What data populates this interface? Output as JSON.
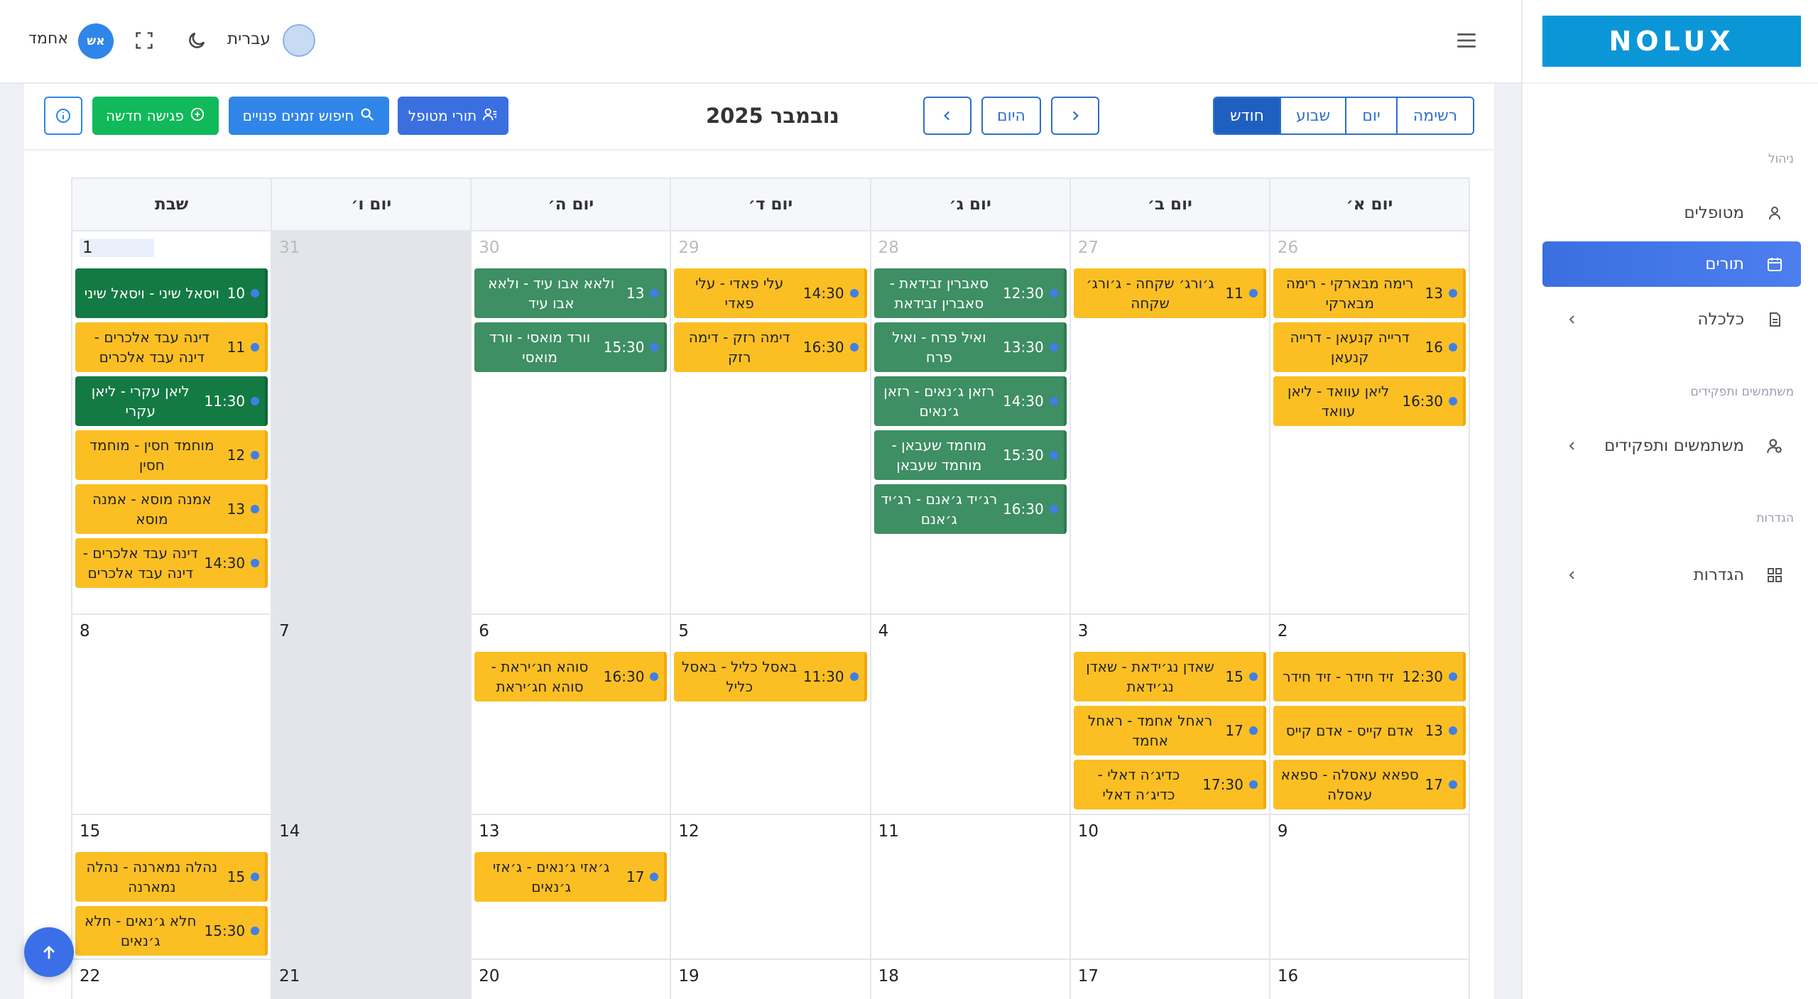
{
  "brand": {
    "logo_text": "NOLUX"
  },
  "sidebar": {
    "section_management": "ניהול",
    "section_users": "משתמשים ותפקידים",
    "section_settings": "הגדרות",
    "items": [
      {
        "label": "מטופלים"
      },
      {
        "label": "תורים"
      },
      {
        "label": "כלכלה"
      },
      {
        "label": "משתמשים ותפקידים"
      },
      {
        "label": "הגדרות"
      }
    ]
  },
  "topbar": {
    "user_name": "אחמד",
    "avatar_initials": "אש",
    "language": "עברית"
  },
  "toolbar": {
    "views": [
      "רשימה",
      "יום",
      "שבוע",
      "חודש"
    ],
    "active_view": "חודש",
    "today_label": "היום",
    "month_title": "נובמבר 2025",
    "patient_queue_label": "תורי מטופל",
    "find_slots_label": "חיפוש זמנים פנויים",
    "new_meeting_label": "פגישה חדשה"
  },
  "calendar": {
    "weekdays": [
      "יום א׳",
      "יום ב׳",
      "יום ג׳",
      "יום ד׳",
      "יום ה׳",
      "יום ו׳",
      "שבת"
    ],
    "weeks": [
      {
        "days": [
          {
            "num": "26",
            "other": true,
            "events": [
              {
                "time": "13",
                "title": "רימה מבארקי - רימה מבארקי",
                "color": "y"
              },
              {
                "time": "16",
                "title": "דרייה קנעאן - דרייה קנעאן",
                "color": "y"
              },
              {
                "time": "16:30",
                "title": "ליאן עוואד - ליאן עוואד",
                "color": "y"
              }
            ]
          },
          {
            "num": "27",
            "other": true,
            "events": [
              {
                "time": "11",
                "title": "ג׳ורג׳ שקחה - ג׳ורג׳ שקחה",
                "color": "y"
              }
            ]
          },
          {
            "num": "28",
            "other": true,
            "events": [
              {
                "time": "12:30",
                "title": "סאברין זבידאת - סאברין זבידאת",
                "color": "g"
              },
              {
                "time": "13:30",
                "title": "ואיל פרח - ואיל פרח",
                "color": "g"
              },
              {
                "time": "14:30",
                "title": "רזאן ג׳נאים - רזאן ג׳נאים",
                "color": "g"
              },
              {
                "time": "15:30",
                "title": "מוחמד שעבאן - מוחמד שעבאן",
                "color": "g"
              },
              {
                "time": "16:30",
                "title": "רג׳יד ג׳אנם - רג׳יד ג׳אנם",
                "color": "g"
              }
            ]
          },
          {
            "num": "29",
            "other": true,
            "events": [
              {
                "time": "14:30",
                "title": "עלי פאדי - עלי פאדי",
                "color": "y"
              },
              {
                "time": "16:30",
                "title": "דימה רזק - דימה רזק",
                "color": "y"
              }
            ]
          },
          {
            "num": "30",
            "other": true,
            "events": [
              {
                "time": "13",
                "title": "ולאא אבו עיד - ולאא אבו עיד",
                "color": "g"
              },
              {
                "time": "15:30",
                "title": "וורד מואסי - וורד מואסי",
                "color": "g"
              }
            ]
          },
          {
            "num": "31",
            "other": true,
            "friday": true,
            "events": []
          },
          {
            "num": "1",
            "today": true,
            "events": [
              {
                "time": "10",
                "title": "ויסאל שיני - ויסאל שיני",
                "color": "dg"
              },
              {
                "time": "11",
                "title": "דינה עבד אלכרים - דינה עבד אלכרים",
                "color": "y"
              },
              {
                "time": "11:30",
                "title": "ליאן עקרי - ליאן עקרי",
                "color": "dg"
              },
              {
                "time": "12",
                "title": "מוחמד חסין - מוחמד חסין",
                "color": "y"
              },
              {
                "time": "13",
                "title": "אמנה מוסא - אמנה מוסא",
                "color": "y"
              },
              {
                "time": "14:30",
                "title": "דינה עבד אלכרים - דינה עבד אלכרים",
                "color": "y"
              }
            ]
          }
        ]
      },
      {
        "days": [
          {
            "num": "2",
            "events": [
              {
                "time": "12:30",
                "title": "זיד חידר - זיד חידר",
                "color": "y"
              },
              {
                "time": "13",
                "title": "אדם קייס - אדם קייס",
                "color": "y"
              },
              {
                "time": "17",
                "title": "ספאא עאסלה - ספאא עאסלה",
                "color": "y"
              }
            ]
          },
          {
            "num": "3",
            "events": [
              {
                "time": "15",
                "title": "שאדן נג׳ידאת - שאדן נג׳ידאת",
                "color": "y"
              },
              {
                "time": "17",
                "title": "ראחל אחמד - ראחל אחמד",
                "color": "y"
              },
              {
                "time": "17:30",
                "title": "כדיג׳ה דאלי - כדיג׳ה דאלי",
                "color": "y"
              }
            ]
          },
          {
            "num": "4",
            "events": []
          },
          {
            "num": "5",
            "events": [
              {
                "time": "11:30",
                "title": "באסל כליל - באסל כליל",
                "color": "y"
              }
            ]
          },
          {
            "num": "6",
            "events": [
              {
                "time": "16:30",
                "title": "סוהא חג׳יראת - סוהא חג׳יראת",
                "color": "y"
              }
            ]
          },
          {
            "num": "7",
            "friday": true,
            "events": []
          },
          {
            "num": "8",
            "events": []
          }
        ]
      },
      {
        "days": [
          {
            "num": "9",
            "events": []
          },
          {
            "num": "10",
            "events": []
          },
          {
            "num": "11",
            "events": []
          },
          {
            "num": "12",
            "events": []
          },
          {
            "num": "13",
            "events": [
              {
                "time": "17",
                "title": "ג׳אזי ג׳נאים - ג׳אזי ג׳נאים",
                "color": "y"
              }
            ]
          },
          {
            "num": "14",
            "friday": true,
            "events": []
          },
          {
            "num": "15",
            "events": [
              {
                "time": "15",
                "title": "נהלה נמארנה - נהלה נמארנה",
                "color": "y"
              },
              {
                "time": "15:30",
                "title": "חלא ג׳נאים - חלא ג׳נאים",
                "color": "y"
              }
            ]
          }
        ]
      },
      {
        "days": [
          {
            "num": "16",
            "events": []
          },
          {
            "num": "17",
            "events": []
          },
          {
            "num": "18",
            "events": []
          },
          {
            "num": "19",
            "events": []
          },
          {
            "num": "20",
            "events": []
          },
          {
            "num": "21",
            "friday": true,
            "events": []
          },
          {
            "num": "22",
            "events": []
          }
        ]
      }
    ]
  },
  "colors": {
    "accent": "#3b6fe0",
    "yellow_event": "#fbbf24",
    "green_event": "#3e8f63",
    "dark_green_event": "#137a43",
    "new_meeting": "#10b95a"
  }
}
